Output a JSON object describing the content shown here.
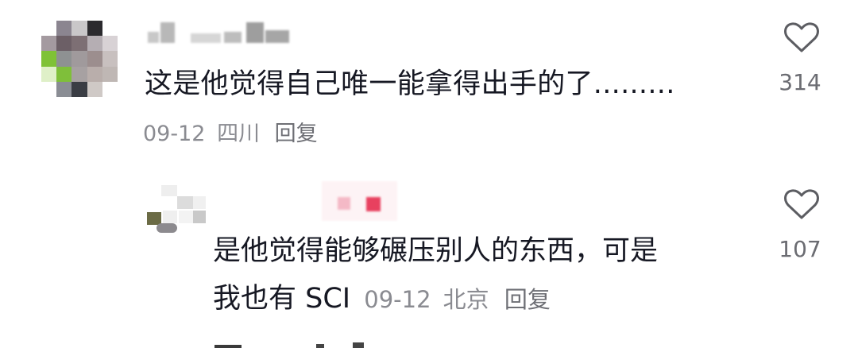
{
  "comments": [
    {
      "text": "这是他觉得自己唯一能拿得出手的了.........",
      "date": "09-12",
      "location": "四川",
      "reply_label": "回复",
      "like_count": "314",
      "like_icon": "heart-outline-icon",
      "avatar": "pixelated-avatar"
    },
    {
      "text_line1": "是他觉得能够碾压别人的东西，可是",
      "text_line2": "我也有 SCI",
      "date": "09-12",
      "location": "北京",
      "reply_label": "回复",
      "like_count": "107",
      "like_icon": "heart-outline-icon",
      "avatar": "pixelated-avatar"
    }
  ],
  "colors": {
    "text": "#161823",
    "meta": "#8a8b91",
    "like_count": "#6b6c72",
    "background": "#ffffff"
  }
}
